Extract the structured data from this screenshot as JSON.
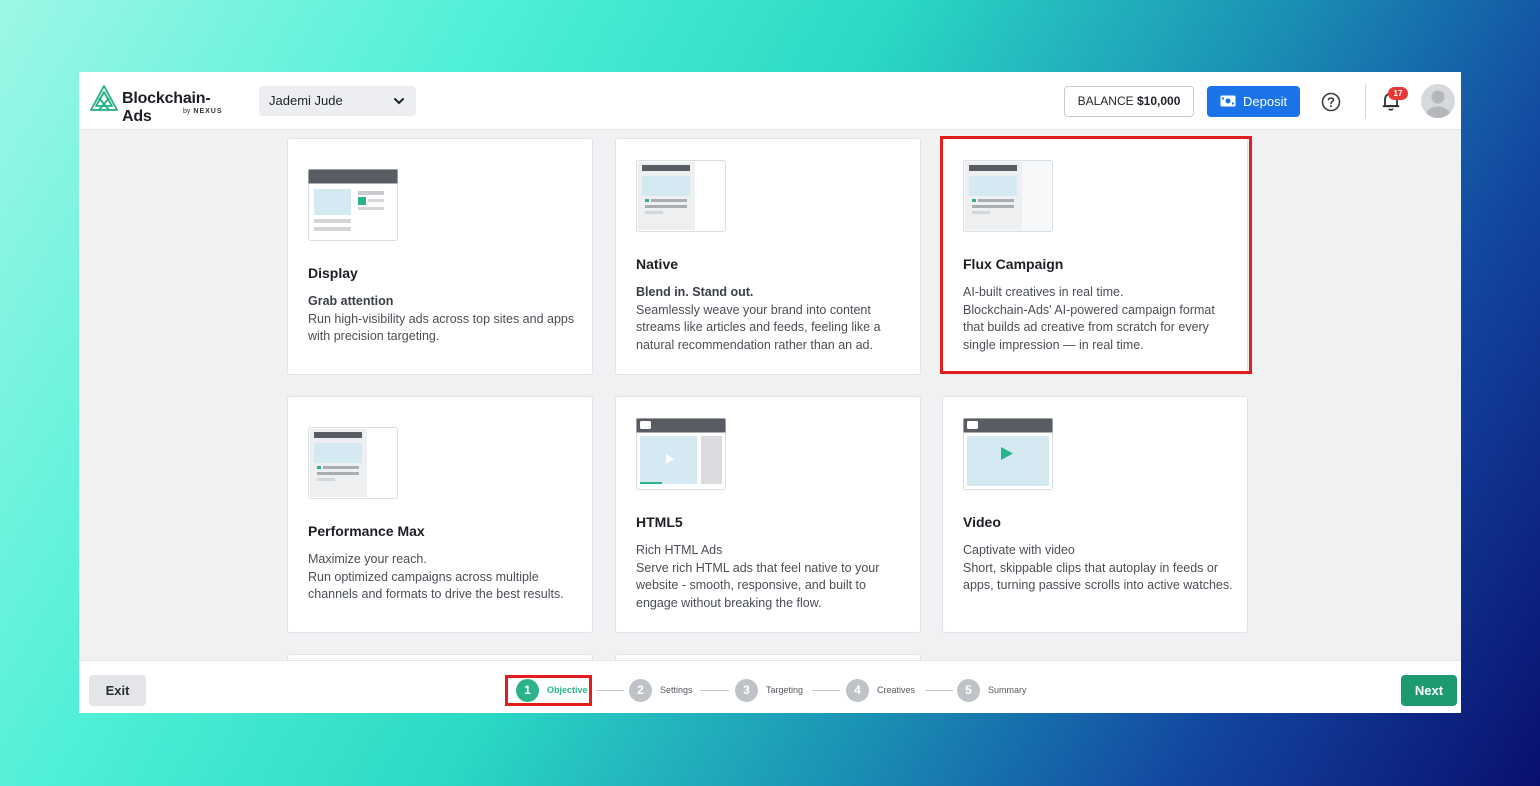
{
  "header": {
    "logo_text": "Blockchain-Ads",
    "logo_by": "by",
    "logo_brand": "NEXUS",
    "account": "Jademi Jude",
    "balance_label": "BALANCE",
    "balance_value": "$10,000",
    "deposit_label": "Deposit",
    "notification_count": "17"
  },
  "cards": [
    {
      "title": "Display",
      "lead": "Grab attention",
      "text": "Run high-visibility ads across top sites and apps with precision targeting."
    },
    {
      "title": "Native",
      "lead": "Blend in. Stand out.",
      "text": "Seamlessly weave your brand into content streams like articles and feeds, feeling like a natural recommendation rather than an ad."
    },
    {
      "title": "Flux Campaign",
      "lead": "AI-built creatives in real time.",
      "text": "Blockchain-Ads' AI-powered campaign format that builds ad creative from scratch for every single impression — in real time."
    },
    {
      "title": "Performance Max",
      "lead": "Maximize your reach.",
      "text": "Run optimized campaigns across multiple channels and formats to drive the best results."
    },
    {
      "title": "HTML5",
      "lead": "Rich HTML Ads",
      "text": "Serve rich HTML ads that feel native to your website - smooth, responsive, and built to engage without breaking the flow."
    },
    {
      "title": "Video",
      "lead": "Captivate with video",
      "text": "Short, skippable clips that autoplay in feeds or apps, turning passive scrolls into active watches."
    }
  ],
  "footer": {
    "exit_label": "Exit",
    "next_label": "Next",
    "steps": [
      {
        "num": "1",
        "label": "Objective"
      },
      {
        "num": "2",
        "label": "Settings"
      },
      {
        "num": "3",
        "label": "Targeting"
      },
      {
        "num": "4",
        "label": "Creatives"
      },
      {
        "num": "5",
        "label": "Summary"
      }
    ]
  },
  "colors": {
    "primary": "#1a73e8",
    "accent_green": "#2bb38a",
    "next_green": "#1e9b6e",
    "highlight_red": "#e11d1d",
    "badge_red": "#e53935"
  }
}
